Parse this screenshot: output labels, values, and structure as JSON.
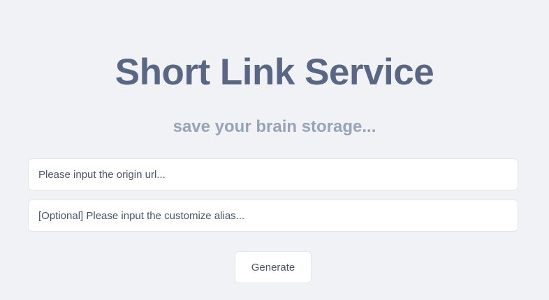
{
  "header": {
    "title": "Short Link Service",
    "subtitle": "save your brain storage..."
  },
  "form": {
    "url_input": {
      "placeholder": "Please input the origin url...",
      "value": ""
    },
    "alias_input": {
      "placeholder": "[Optional] Please input the customize alias...",
      "value": ""
    },
    "generate_label": "Generate"
  },
  "colors": {
    "background": "#f1f2f6",
    "title": "#5a6784",
    "subtitle": "#97a3b8",
    "text": "#4a5469",
    "border": "#e2e5ec"
  }
}
